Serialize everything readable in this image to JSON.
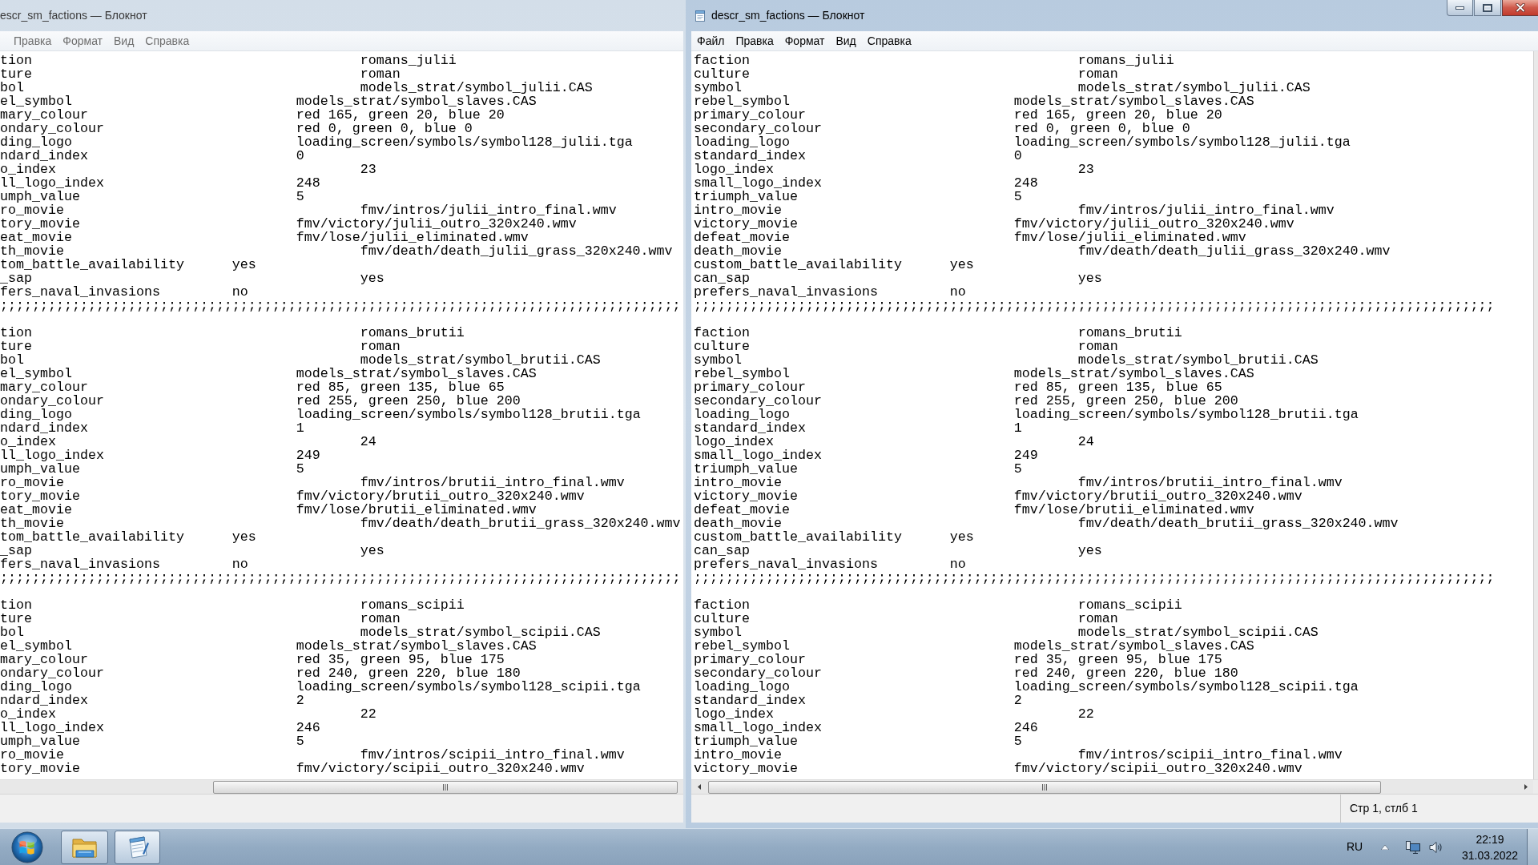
{
  "windows": [
    {
      "title": "escr_sm_factions — Блокнот",
      "active": false,
      "menu": [
        "Правка",
        "Формат",
        "Вид",
        "Справка"
      ],
      "document": {
        "blocks": [
          {
            "entries": [
              {
                "key": "tion",
                "value": "romans_julii"
              },
              {
                "key": "ture",
                "value": "roman"
              },
              {
                "key": "bol",
                "value": "models_strat/symbol_julii.CAS"
              },
              {
                "key": "el_symbol",
                "value": "models_strat/symbol_slaves.CAS"
              },
              {
                "key": "mary_colour",
                "value": "red 165, green 20, blue 20"
              },
              {
                "key": "ondary_colour",
                "value": "red 0, green 0, blue 0"
              },
              {
                "key": "ding_logo",
                "value": "loading_screen/symbols/symbol128_julii.tga"
              },
              {
                "key": "ndard_index",
                "value": "0"
              },
              {
                "key": "o_index",
                "value": "23"
              },
              {
                "key": "ll_logo_index",
                "value": "248"
              },
              {
                "key": "umph_value",
                "value": "5"
              },
              {
                "key": "ro_movie",
                "value": "fmv/intros/julii_intro_final.wmv"
              },
              {
                "key": "tory_movie",
                "value": "fmv/victory/julii_outro_320x240.wmv"
              },
              {
                "key": "eat_movie",
                "value": "fmv/lose/julii_eliminated.wmv"
              },
              {
                "key": "th_movie",
                "value": "fmv/death/death_julii_grass_320x240.wmv"
              },
              {
                "key": "tom_battle_availability",
                "value": "yes"
              },
              {
                "key": "_sap",
                "value": "yes"
              },
              {
                "key": "fers_naval_invasions",
                "value": "no"
              }
            ],
            "separator": ";;;;;;;;;;;;;;;;;;;;;;;;;;;;;;;;;;;;;;;;;;;;;;;;;;;;;;;;;;;;;;;;;;;;;;;;;;;;;;;;;;;;;"
          },
          {
            "entries": [
              {
                "key": "tion",
                "value": "romans_brutii"
              },
              {
                "key": "ture",
                "value": "roman"
              },
              {
                "key": "bol",
                "value": "models_strat/symbol_brutii.CAS"
              },
              {
                "key": "el_symbol",
                "value": "models_strat/symbol_slaves.CAS"
              },
              {
                "key": "mary_colour",
                "value": "red 85, green 135, blue 65"
              },
              {
                "key": "ondary_colour",
                "value": "red 255, green 250, blue 200"
              },
              {
                "key": "ding_logo",
                "value": "loading_screen/symbols/symbol128_brutii.tga"
              },
              {
                "key": "ndard_index",
                "value": "1"
              },
              {
                "key": "o_index",
                "value": "24"
              },
              {
                "key": "ll_logo_index",
                "value": "249"
              },
              {
                "key": "umph_value",
                "value": "5"
              },
              {
                "key": "ro_movie",
                "value": "fmv/intros/brutii_intro_final.wmv"
              },
              {
                "key": "tory_movie",
                "value": "fmv/victory/brutii_outro_320x240.wmv"
              },
              {
                "key": "eat_movie",
                "value": "fmv/lose/brutii_eliminated.wmv"
              },
              {
                "key": "th_movie",
                "value": "fmv/death/death_brutii_grass_320x240.wmv"
              },
              {
                "key": "tom_battle_availability",
                "value": "yes"
              },
              {
                "key": "_sap",
                "value": "yes"
              },
              {
                "key": "fers_naval_invasions",
                "value": "no"
              }
            ],
            "separator": ";;;;;;;;;;;;;;;;;;;;;;;;;;;;;;;;;;;;;;;;;;;;;;;;;;;;;;;;;;;;;;;;;;;;;;;;;;;;;;;;;;;;;"
          },
          {
            "entries": [
              {
                "key": "tion",
                "value": "romans_scipii"
              },
              {
                "key": "ture",
                "value": "roman"
              },
              {
                "key": "bol",
                "value": "models_strat/symbol_scipii.CAS"
              },
              {
                "key": "el_symbol",
                "value": "models_strat/symbol_slaves.CAS"
              },
              {
                "key": "mary_colour",
                "value": "red 35, green 95, blue 175"
              },
              {
                "key": "ondary_colour",
                "value": "red 240, green 220, blue 180"
              },
              {
                "key": "ding_logo",
                "value": "loading_screen/symbols/symbol128_scipii.tga"
              },
              {
                "key": "ndard_index",
                "value": "2"
              },
              {
                "key": "o_index",
                "value": "22"
              },
              {
                "key": "ll_logo_index",
                "value": "246"
              },
              {
                "key": "umph_value",
                "value": "5"
              },
              {
                "key": "ro_movie",
                "value": "fmv/intros/scipii_intro_final.wmv"
              },
              {
                "key": "tory_movie",
                "value": "fmv/victory/scipii_outro_320x240.wmv"
              }
            ]
          }
        ]
      }
    },
    {
      "title": "descr_sm_factions — Блокнот",
      "active": true,
      "menu": [
        "Файл",
        "Правка",
        "Формат",
        "Вид",
        "Справка"
      ],
      "document": {
        "blocks": [
          {
            "entries": [
              {
                "key": "faction",
                "value": "romans_julii"
              },
              {
                "key": "culture",
                "value": "roman"
              },
              {
                "key": "symbol",
                "value": "models_strat/symbol_julii.CAS"
              },
              {
                "key": "rebel_symbol",
                "value": "models_strat/symbol_slaves.CAS"
              },
              {
                "key": "primary_colour",
                "value": "red 165, green 20, blue 20"
              },
              {
                "key": "secondary_colour",
                "value": "red 0, green 0, blue 0"
              },
              {
                "key": "loading_logo",
                "value": "loading_screen/symbols/symbol128_julii.tga"
              },
              {
                "key": "standard_index",
                "value": "0"
              },
              {
                "key": "logo_index",
                "value": "23"
              },
              {
                "key": "small_logo_index",
                "value": "248"
              },
              {
                "key": "triumph_value",
                "value": "5"
              },
              {
                "key": "intro_movie",
                "value": "fmv/intros/julii_intro_final.wmv"
              },
              {
                "key": "victory_movie",
                "value": "fmv/victory/julii_outro_320x240.wmv"
              },
              {
                "key": "defeat_movie",
                "value": "fmv/lose/julii_eliminated.wmv"
              },
              {
                "key": "death_movie",
                "value": "fmv/death/death_julii_grass_320x240.wmv"
              },
              {
                "key": "custom_battle_availability",
                "value": "yes"
              },
              {
                "key": "can_sap",
                "value": "yes"
              },
              {
                "key": "prefers_naval_invasions",
                "value": "no"
              }
            ],
            "separator": ";;;;;;;;;;;;;;;;;;;;;;;;;;;;;;;;;;;;;;;;;;;;;;;;;;;;;;;;;;;;;;;;;;;;;;;;;;;;;;;;;;;;;;;;;;;;;;;;;;;;"
          },
          {
            "entries": [
              {
                "key": "faction",
                "value": "romans_brutii"
              },
              {
                "key": "culture",
                "value": "roman"
              },
              {
                "key": "symbol",
                "value": "models_strat/symbol_brutii.CAS"
              },
              {
                "key": "rebel_symbol",
                "value": "models_strat/symbol_slaves.CAS"
              },
              {
                "key": "primary_colour",
                "value": "red 85, green 135, blue 65"
              },
              {
                "key": "secondary_colour",
                "value": "red 255, green 250, blue 200"
              },
              {
                "key": "loading_logo",
                "value": "loading_screen/symbols/symbol128_brutii.tga"
              },
              {
                "key": "standard_index",
                "value": "1"
              },
              {
                "key": "logo_index",
                "value": "24"
              },
              {
                "key": "small_logo_index",
                "value": "249"
              },
              {
                "key": "triumph_value",
                "value": "5"
              },
              {
                "key": "intro_movie",
                "value": "fmv/intros/brutii_intro_final.wmv"
              },
              {
                "key": "victory_movie",
                "value": "fmv/victory/brutii_outro_320x240.wmv"
              },
              {
                "key": "defeat_movie",
                "value": "fmv/lose/brutii_eliminated.wmv"
              },
              {
                "key": "death_movie",
                "value": "fmv/death/death_brutii_grass_320x240.wmv"
              },
              {
                "key": "custom_battle_availability",
                "value": "yes"
              },
              {
                "key": "can_sap",
                "value": "yes"
              },
              {
                "key": "prefers_naval_invasions",
                "value": "no"
              }
            ],
            "separator": ";;;;;;;;;;;;;;;;;;;;;;;;;;;;;;;;;;;;;;;;;;;;;;;;;;;;;;;;;;;;;;;;;;;;;;;;;;;;;;;;;;;;;;;;;;;;;;;;;;;;"
          },
          {
            "entries": [
              {
                "key": "faction",
                "value": "romans_scipii"
              },
              {
                "key": "culture",
                "value": "roman"
              },
              {
                "key": "symbol",
                "value": "models_strat/symbol_scipii.CAS"
              },
              {
                "key": "rebel_symbol",
                "value": "models_strat/symbol_slaves.CAS"
              },
              {
                "key": "primary_colour",
                "value": "red 35, green 95, blue 175"
              },
              {
                "key": "secondary_colour",
                "value": "red 240, green 220, blue 180"
              },
              {
                "key": "loading_logo",
                "value": "loading_screen/symbols/symbol128_scipii.tga"
              },
              {
                "key": "standard_index",
                "value": "2"
              },
              {
                "key": "logo_index",
                "value": "22"
              },
              {
                "key": "small_logo_index",
                "value": "246"
              },
              {
                "key": "triumph_value",
                "value": "5"
              },
              {
                "key": "intro_movie",
                "value": "fmv/intros/scipii_intro_final.wmv"
              },
              {
                "key": "victory_movie",
                "value": "fmv/victory/scipii_outro_320x240.wmv"
              }
            ]
          }
        ]
      },
      "status_bar": {
        "position": "Стр 1, стлб 1"
      }
    }
  ],
  "taskbar": {
    "language": "RU",
    "clock": {
      "time": "22:19",
      "date": "31.03.2022"
    }
  }
}
